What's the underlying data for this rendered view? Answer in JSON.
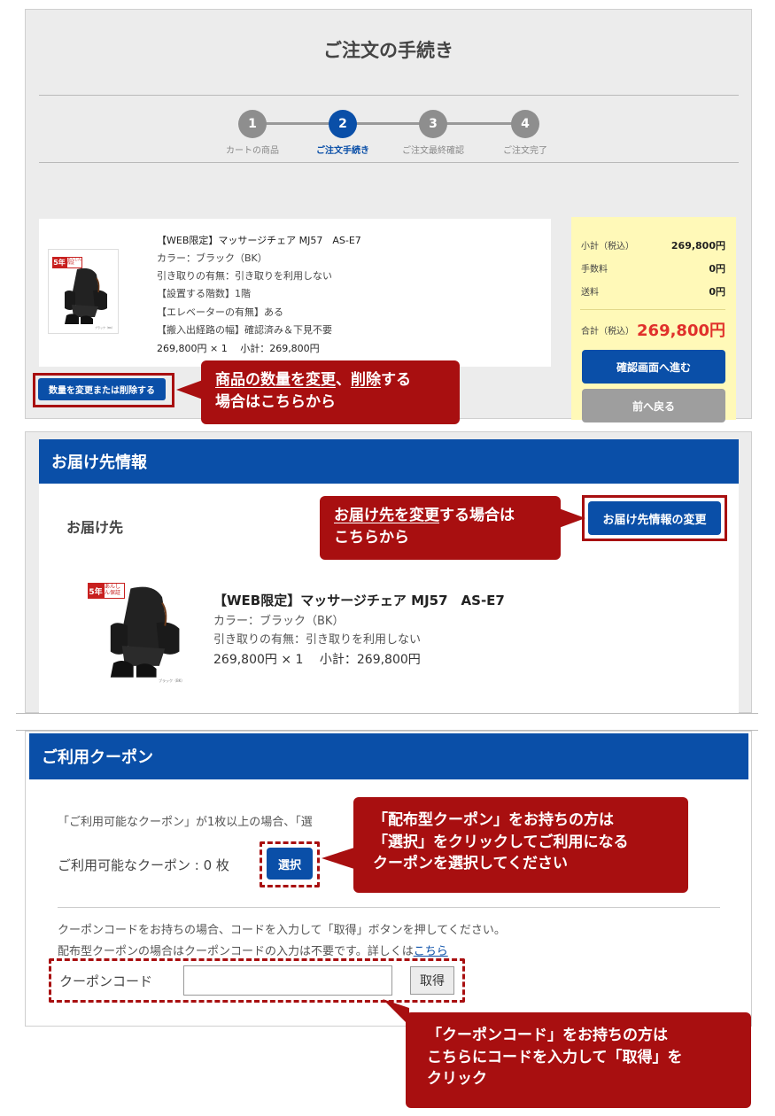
{
  "order": {
    "title": "ご注文の手続き",
    "steps": [
      {
        "num": "1",
        "label": "カートの商品"
      },
      {
        "num": "2",
        "label": "ご注文手続き"
      },
      {
        "num": "3",
        "label": "ご注文最終確認"
      },
      {
        "num": "4",
        "label": "ご注文完了"
      }
    ],
    "active_step": 2
  },
  "cart_item": {
    "name": "【WEB限定】マッサージチェア MJ57　AS-E7",
    "color": "カラー：ブラック（BK）",
    "pickup": "引き取りの有無：引き取りを利用しない",
    "floor": "【設置する階数】1階",
    "elevator": "【エレベーターの有無】ある",
    "path": "【搬入出経路の幅】確認済み＆下見不要",
    "price_line": "269,800円 × 1　 小計：269,800円",
    "badge": "5年",
    "badge_sub": "あんしん保証",
    "thumb_caption": "ブラック（BK）"
  },
  "summary": {
    "subtotal_label": "小計（税込）",
    "subtotal_value": "269,800円",
    "fee_label": "手数料",
    "fee_value": "0円",
    "shipping_label": "送料",
    "shipping_value": "0円",
    "total_label": "合計（税込）",
    "total_value": "269,800円",
    "confirm_button": "確認画面へ進む",
    "back_button": "前へ戻る"
  },
  "change_qty_button": "数量を変更または削除する",
  "callouts": {
    "qty_line1_u": "商品の数量を変更",
    "qty_line1_sep": "、",
    "qty_line1_u2": "削除",
    "qty_line1_rest": "する",
    "qty_line2": "場合はこちらから",
    "dest_line1_u": "お届け先を変更",
    "dest_line1_rest": "する場合は",
    "dest_line2": "こちらから",
    "coupon_line1": "「配布型クーポン」をお持ちの方は",
    "coupon_line2": "「選択」をクリックしてご利用になる",
    "coupon_line3": "クーポンを選択してください",
    "code_line1": "「クーポンコード」をお持ちの方は",
    "code_line2": "こちらにコードを入力して「取得」を",
    "code_line3": "クリック"
  },
  "delivery": {
    "header": "お届け先情報",
    "label": "お届け先",
    "change_button": "お届け先情報の変更",
    "item_name": "【WEB限定】マッサージチェア MJ57　AS-E7",
    "item_color": "カラー：ブラック（BK）",
    "item_pickup": "引き取りの有無：引き取りを利用しない",
    "item_price": "269,800円 × 1　 小計：269,800円"
  },
  "coupon": {
    "header": "ご利用クーポン",
    "intro": "「ご利用可能なクーポン」が1枚以上の場合、「選",
    "available_label": "ご利用可能なクーポン : 0 枚",
    "select_button": "選択",
    "code_info1": "クーポンコードをお持ちの場合、コードを入力して「取得」ボタンを押してください。",
    "code_info2": "配布型クーポンの場合はクーポンコードの入力は不要です。詳しくは",
    "code_info2_link": "こちら",
    "code_label": "クーポンコード",
    "code_value": "",
    "get_button": "取得"
  },
  "colors": {
    "brand_blue": "#0a4fa8",
    "callout_red": "#a80f10",
    "total_red": "#e0302b",
    "summary_yellow": "#fff9b8"
  }
}
